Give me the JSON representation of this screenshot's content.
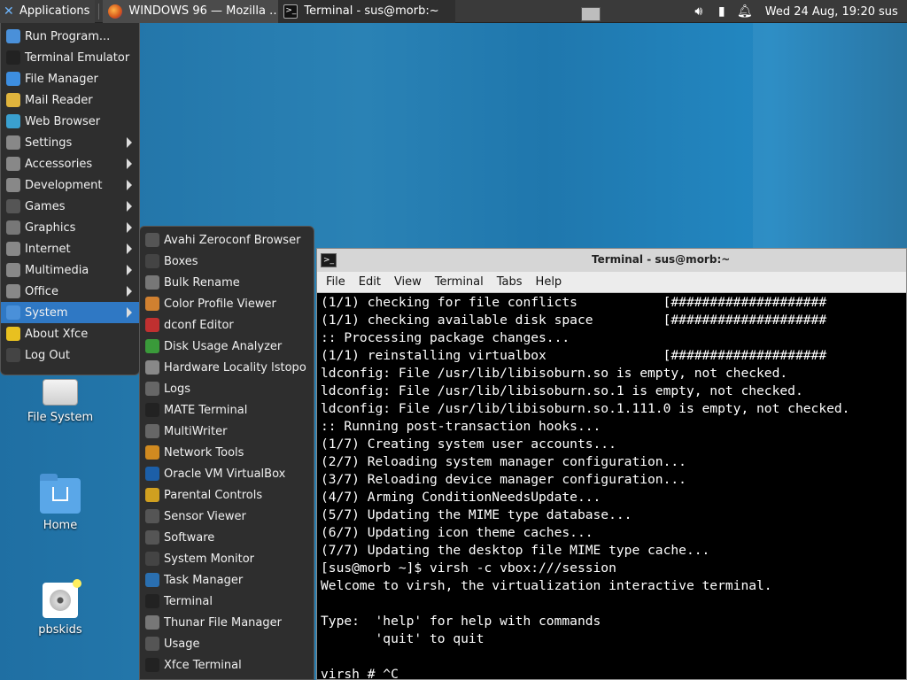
{
  "panel": {
    "applications_label": "Applications",
    "tasks": [
      {
        "label": "WINDOWS 96 — Mozilla …",
        "icon": "firefox-icon"
      },
      {
        "label": "Terminal - sus@morb:~",
        "icon": "terminal-icon"
      }
    ],
    "clock": "Wed 24 Aug, 19:20",
    "user": "sus"
  },
  "menu": {
    "items": [
      {
        "label": "Run Program...",
        "icon": "run-icon",
        "color": "#4a90d9"
      },
      {
        "label": "Terminal Emulator",
        "icon": "terminal-icon",
        "color": "#222222"
      },
      {
        "label": "File Manager",
        "icon": "folder-icon",
        "color": "#3d8ee0"
      },
      {
        "label": "Mail Reader",
        "icon": "mail-icon",
        "color": "#e0b43d"
      },
      {
        "label": "Web Browser",
        "icon": "globe-icon",
        "color": "#3aa0d0"
      },
      {
        "label": "Settings",
        "icon": "settings-icon",
        "color": "#888888"
      },
      {
        "label": "Accessories",
        "icon": "accessories-icon",
        "color": "#888888"
      },
      {
        "label": "Development",
        "icon": "development-icon",
        "color": "#888888"
      },
      {
        "label": "Games",
        "icon": "gamepad-icon",
        "color": "#555555"
      },
      {
        "label": "Graphics",
        "icon": "graphics-icon",
        "color": "#777777"
      },
      {
        "label": "Internet",
        "icon": "internet-icon",
        "color": "#888888"
      },
      {
        "label": "Multimedia",
        "icon": "multimedia-icon",
        "color": "#888888"
      },
      {
        "label": "Office",
        "icon": "office-icon",
        "color": "#888888"
      },
      {
        "label": "System",
        "icon": "gear-icon",
        "color": "#4a90d9"
      },
      {
        "label": "About Xfce",
        "icon": "star-icon",
        "color": "#e8c020"
      },
      {
        "label": "Log Out",
        "icon": "logout-icon",
        "color": "#444444"
      }
    ]
  },
  "submenu": {
    "items": [
      {
        "label": "Avahi Zeroconf Browser",
        "icon": "network-icon",
        "color": "#555555"
      },
      {
        "label": "Boxes",
        "icon": "boxes-icon",
        "color": "#444444"
      },
      {
        "label": "Bulk Rename",
        "icon": "rename-icon",
        "color": "#777777"
      },
      {
        "label": "Color Profile Viewer",
        "icon": "color-icon",
        "color": "#d08030"
      },
      {
        "label": "dconf Editor",
        "icon": "dconf-icon",
        "color": "#c03030"
      },
      {
        "label": "Disk Usage Analyzer",
        "icon": "disk-icon",
        "color": "#3a9a3a"
      },
      {
        "label": "Hardware Locality lstopo",
        "icon": "hardware-icon",
        "color": "#888888"
      },
      {
        "label": "Logs",
        "icon": "logs-icon",
        "color": "#666666"
      },
      {
        "label": "MATE Terminal",
        "icon": "terminal-icon",
        "color": "#222222"
      },
      {
        "label": "MultiWriter",
        "icon": "usb-icon",
        "color": "#666666"
      },
      {
        "label": "Network Tools",
        "icon": "network-tools-icon",
        "color": "#d08a20"
      },
      {
        "label": "Oracle VM VirtualBox",
        "icon": "virtualbox-icon",
        "color": "#1c5fa8"
      },
      {
        "label": "Parental Controls",
        "icon": "parental-icon",
        "color": "#d0a020"
      },
      {
        "label": "Sensor Viewer",
        "icon": "sensor-icon",
        "color": "#555555"
      },
      {
        "label": "Software",
        "icon": "software-icon",
        "color": "#555555"
      },
      {
        "label": "System Monitor",
        "icon": "monitor-icon",
        "color": "#444444"
      },
      {
        "label": "Task Manager",
        "icon": "task-icon",
        "color": "#2a6fb0"
      },
      {
        "label": "Terminal",
        "icon": "terminal-icon",
        "color": "#222222"
      },
      {
        "label": "Thunar File Manager",
        "icon": "thunar-icon",
        "color": "#777777"
      },
      {
        "label": "Usage",
        "icon": "usage-icon",
        "color": "#555555"
      },
      {
        "label": "Xfce Terminal",
        "icon": "terminal-icon",
        "color": "#222222"
      }
    ]
  },
  "desktop": {
    "icons": [
      {
        "label": "File System"
      },
      {
        "label": "Home"
      },
      {
        "label": "pbskids"
      }
    ]
  },
  "terminal": {
    "title": "Terminal - sus@morb:~",
    "menu": [
      "File",
      "Edit",
      "View",
      "Terminal",
      "Tabs",
      "Help"
    ],
    "lines": [
      "(1/1) checking for file conflicts           [####################",
      "(1/1) checking available disk space         [####################",
      ":: Processing package changes...",
      "(1/1) reinstalling virtualbox               [####################",
      "ldconfig: File /usr/lib/libisoburn.so is empty, not checked.",
      "ldconfig: File /usr/lib/libisoburn.so.1 is empty, not checked.",
      "ldconfig: File /usr/lib/libisoburn.so.1.111.0 is empty, not checked.",
      ":: Running post-transaction hooks...",
      "(1/7) Creating system user accounts...",
      "(2/7) Reloading system manager configuration...",
      "(3/7) Reloading device manager configuration...",
      "(4/7) Arming ConditionNeedsUpdate...",
      "(5/7) Updating the MIME type database...",
      "(6/7) Updating icon theme caches...",
      "(7/7) Updating the desktop file MIME type cache...",
      "[sus@morb ~]$ virsh -c vbox:///session",
      "Welcome to virsh, the virtualization interactive terminal.",
      "",
      "Type:  'help' for help with commands",
      "       'quit' to quit",
      "",
      "virsh # ^C"
    ]
  }
}
